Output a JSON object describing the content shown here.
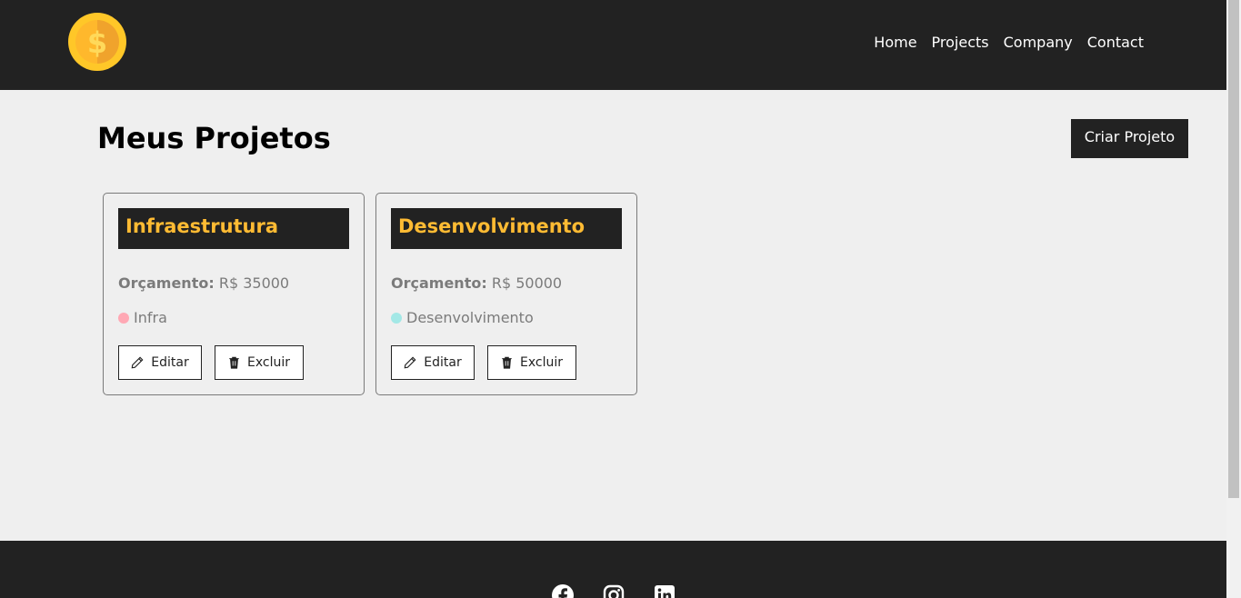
{
  "nav": {
    "items": [
      "Home",
      "Projects",
      "Company",
      "Contact"
    ]
  },
  "page": {
    "title": "Meus Projetos",
    "create_button": "Criar Projeto"
  },
  "projects": [
    {
      "name": "Infraestrutura",
      "budget_label": "Orçamento:",
      "budget_value": "R$ 35000",
      "category": "Infra",
      "category_color": "#ffa8b4",
      "edit_label": "Editar",
      "delete_label": "Excluir"
    },
    {
      "name": "Desenvolvimento",
      "budget_label": "Orçamento:",
      "budget_value": "R$ 50000",
      "category": "Desenvolvimento",
      "category_color": "#a3e8e6",
      "edit_label": "Editar",
      "delete_label": "Excluir"
    }
  ],
  "footer": {
    "social_icons": [
      "facebook-icon",
      "instagram-icon",
      "linkedin-icon"
    ]
  },
  "colors": {
    "dark": "#222222",
    "accent": "#ffbb33",
    "background": "#efefef"
  }
}
